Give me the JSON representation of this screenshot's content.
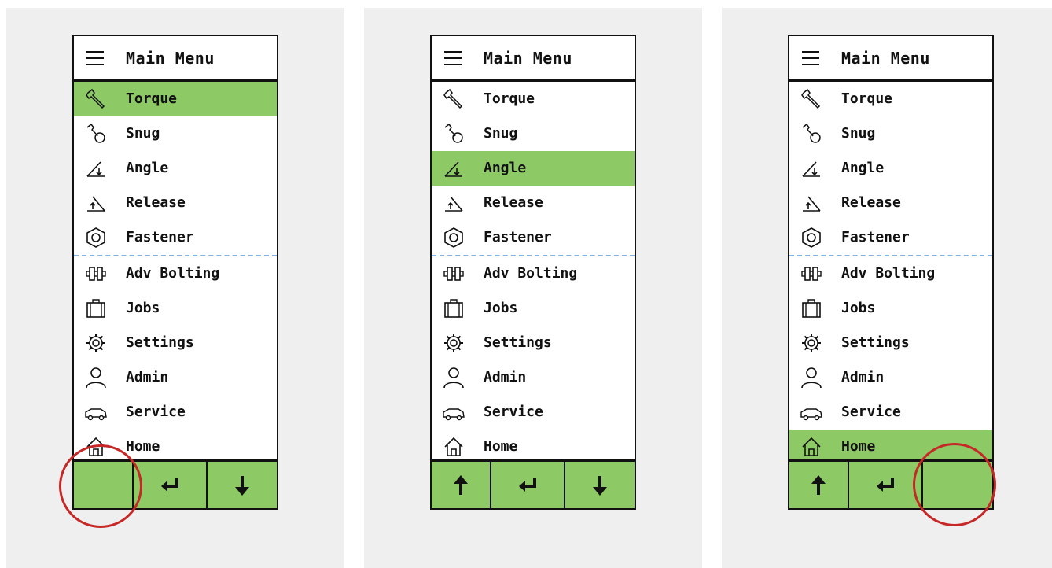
{
  "colors": {
    "selection": "#8dc964",
    "highlight_circle": "#c62828",
    "divider": "#7fb3e6"
  },
  "screens": [
    {
      "title": "Main Menu",
      "selected": "Torque",
      "items": [
        "Torque",
        "Snug",
        "Angle",
        "Release",
        "Fastener",
        "Adv Bolting",
        "Jobs",
        "Settings",
        "Admin",
        "Service",
        "Home"
      ],
      "buttons": [
        {
          "icon": "empty",
          "highlighted": true
        },
        {
          "icon": "enter-arrow-icon",
          "highlighted": false
        },
        {
          "icon": "down-arrow-icon",
          "highlighted": false
        }
      ]
    },
    {
      "title": "Main Menu",
      "selected": "Angle",
      "items": [
        "Torque",
        "Snug",
        "Angle",
        "Release",
        "Fastener",
        "Adv Bolting",
        "Jobs",
        "Settings",
        "Admin",
        "Service",
        "Home"
      ],
      "buttons": [
        {
          "icon": "up-arrow-icon",
          "highlighted": false
        },
        {
          "icon": "enter-arrow-icon",
          "highlighted": false
        },
        {
          "icon": "down-arrow-icon",
          "highlighted": false
        }
      ]
    },
    {
      "title": "Main Menu",
      "selected": "Home",
      "items": [
        "Torque",
        "Snug",
        "Angle",
        "Release",
        "Fastener",
        "Adv Bolting",
        "Jobs",
        "Settings",
        "Admin",
        "Service",
        "Home"
      ],
      "buttons": [
        {
          "icon": "up-arrow-icon",
          "highlighted": false
        },
        {
          "icon": "enter-arrow-icon",
          "highlighted": false
        },
        {
          "icon": "empty",
          "highlighted": true
        }
      ]
    }
  ]
}
